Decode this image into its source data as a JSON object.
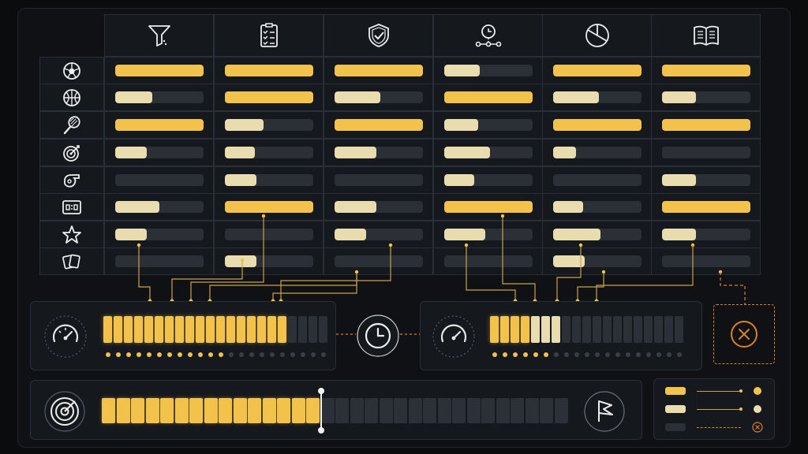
{
  "colors": {
    "gold": "#f2c24a",
    "cream": "#e9dcae",
    "track": "#2b2f36",
    "orange": "#d9822b",
    "line": "#c9a24a"
  },
  "columns": [
    {
      "icon": "funnel-icon"
    },
    {
      "icon": "checklist-icon"
    },
    {
      "icon": "shield-check-icon"
    },
    {
      "icon": "timeline-clock-icon"
    },
    {
      "icon": "pie-chart-icon"
    },
    {
      "icon": "open-book-icon"
    }
  ],
  "rows": [
    {
      "icon": "soccer-ball-icon",
      "levels": [
        [
          1,
          "gold"
        ],
        [
          1,
          "gold"
        ],
        [
          1,
          "gold"
        ],
        [
          0.4,
          "cream"
        ],
        [
          1,
          "gold"
        ],
        [
          1,
          "gold"
        ]
      ]
    },
    {
      "icon": "basketball-icon",
      "levels": [
        [
          0.42,
          "cream"
        ],
        [
          1,
          "gold"
        ],
        [
          0.52,
          "cream"
        ],
        [
          1,
          "gold"
        ],
        [
          0.52,
          "cream"
        ],
        [
          0.38,
          "cream"
        ]
      ]
    },
    {
      "icon": "tennis-racket-icon",
      "levels": [
        [
          1,
          "gold"
        ],
        [
          0.44,
          "cream"
        ],
        [
          1,
          "gold"
        ],
        [
          0.38,
          "cream"
        ],
        [
          1,
          "gold"
        ],
        [
          1,
          "gold"
        ]
      ]
    },
    {
      "icon": "target-arrow-icon",
      "levels": [
        [
          0.36,
          "cream"
        ],
        [
          0.34,
          "cream"
        ],
        [
          0.47,
          "cream"
        ],
        [
          0.52,
          "cream"
        ],
        [
          0.26,
          "cream"
        ],
        [
          0,
          "cream"
        ]
      ]
    },
    {
      "icon": "whistle-icon",
      "levels": [
        [
          0,
          "cream"
        ],
        [
          0.36,
          "cream"
        ],
        [
          0,
          "cream"
        ],
        [
          0.34,
          "cream"
        ],
        [
          0,
          "cream"
        ],
        [
          0.38,
          "cream"
        ]
      ]
    },
    {
      "icon": "scoreboard-icon",
      "levels": [
        [
          0.5,
          "cream"
        ],
        [
          1,
          "gold"
        ],
        [
          0.47,
          "cream"
        ],
        [
          1,
          "gold"
        ],
        [
          0.34,
          "cream"
        ],
        [
          1,
          "gold"
        ]
      ]
    },
    {
      "icon": "star-icon",
      "levels": [
        [
          0.36,
          "cream"
        ],
        [
          0,
          "cream"
        ],
        [
          0.36,
          "cream"
        ],
        [
          0.46,
          "cream"
        ],
        [
          0.54,
          "cream"
        ],
        [
          0.38,
          "cream"
        ]
      ]
    },
    {
      "icon": "cards-icon",
      "levels": [
        [
          0,
          "cream"
        ],
        [
          0.36,
          "cream"
        ],
        [
          0,
          "cream"
        ],
        [
          0,
          "cream"
        ],
        [
          0.36,
          "cream"
        ],
        [
          0,
          "cream"
        ]
      ]
    }
  ],
  "meter_left": {
    "icon": "speedometer-icon",
    "segments_total": 22,
    "segments_filled": 18,
    "dots_total": 22,
    "dots_filled": 12
  },
  "clock_node": {
    "icon": "clock-icon"
  },
  "meter_right": {
    "icon": "speedometer-icon",
    "segments_total": 19,
    "segments_gold": 4,
    "segments_cream": 3,
    "dots_total": 19,
    "dots_filled": 6
  },
  "error_node": {
    "icon": "close-circle-icon"
  },
  "progress_main": {
    "icon": "target-icon",
    "end_icon": "flag-icon",
    "segments_total": 32,
    "progress": 0.47
  },
  "legend": {
    "items": [
      {
        "swatch": "gold",
        "end": "dot"
      },
      {
        "swatch": "cream",
        "end": "dot"
      },
      {
        "swatch": "track",
        "end": "close-circle-icon"
      }
    ]
  }
}
